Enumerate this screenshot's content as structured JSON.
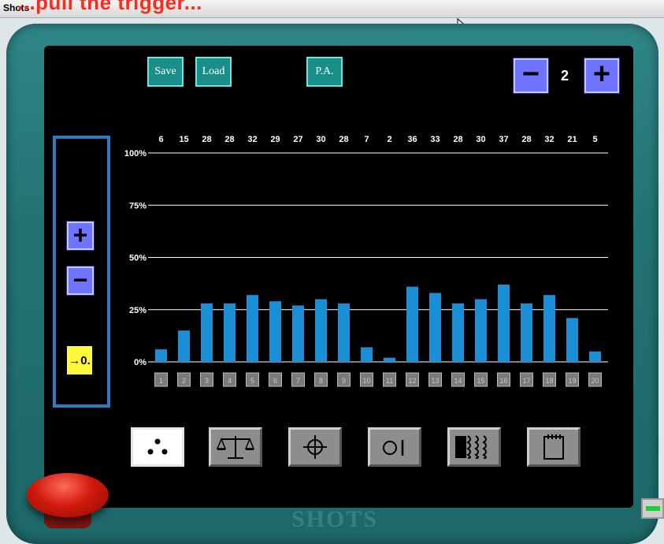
{
  "window": {
    "title": "Shots"
  },
  "overlay_caption": "...pull the trigger...",
  "toolbar": {
    "save_label": "Save",
    "load_label": "Load",
    "pa_label": "P.A."
  },
  "counter": {
    "minus_label": "−",
    "value": "2",
    "plus_label": "+"
  },
  "left_panel": {
    "plus_label": "+",
    "minus_label": "−",
    "zero_label": "→0."
  },
  "bottom_icons": [
    {
      "name": "dots-icon",
      "active": true
    },
    {
      "name": "balance-scale-icon",
      "active": false
    },
    {
      "name": "crosshair-icon",
      "active": false
    },
    {
      "name": "o-one-icon",
      "active": false
    },
    {
      "name": "shots-pattern-icon",
      "active": false
    },
    {
      "name": "notepad-icon",
      "active": false
    }
  ],
  "logo_text": "SHOTS",
  "colors": {
    "bar": "#1a8fd6",
    "frame": "#237272",
    "button_teal": "#1a8e88",
    "button_blue": "#6f74ff",
    "zero_button": "#fff83a"
  },
  "chart_data": {
    "type": "bar",
    "categories": [
      "1",
      "2",
      "3",
      "4",
      "5",
      "6",
      "7",
      "8",
      "9",
      "10",
      "11",
      "12",
      "13",
      "14",
      "15",
      "16",
      "17",
      "18",
      "19",
      "20"
    ],
    "values": [
      6,
      15,
      28,
      28,
      32,
      29,
      27,
      30,
      28,
      7,
      2,
      36,
      33,
      28,
      30,
      37,
      28,
      32,
      21,
      5
    ],
    "value_labels": [
      "6",
      "15",
      "28",
      "28",
      "32",
      "29",
      "27",
      "30",
      "28",
      "7",
      "2",
      "36",
      "33",
      "28",
      "30",
      "37",
      "28",
      "32",
      "21",
      "5"
    ],
    "y_ticks": [
      "100%",
      "75%",
      "50%",
      "25%",
      "0%"
    ],
    "ylim": [
      0,
      100
    ],
    "grid": true
  }
}
